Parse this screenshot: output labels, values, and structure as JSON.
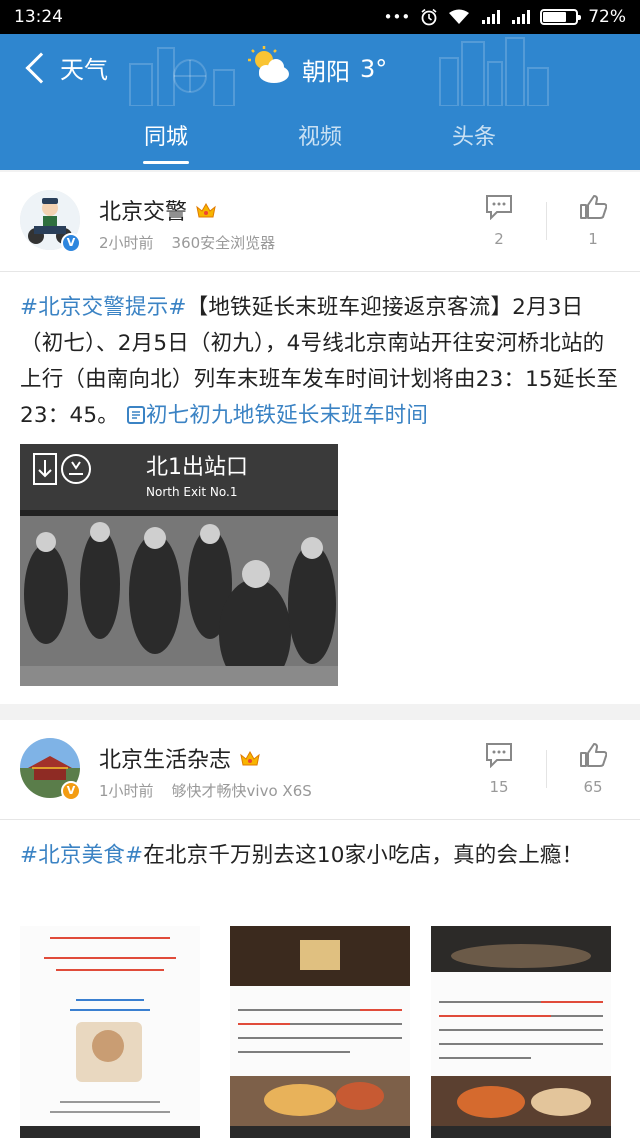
{
  "status_bar": {
    "time": "13:24",
    "battery_text": "72%",
    "battery_level": 0.72,
    "icons": [
      "dots-icon",
      "alarm-icon",
      "wifi-icon",
      "signal-icon",
      "signal-icon",
      "battery-icon"
    ]
  },
  "header": {
    "back_label": "天气",
    "location": "朝阳",
    "temperature": "3°",
    "weather_icon": "partly-cloudy-icon",
    "bg_color": "#2f86cf"
  },
  "tabs": [
    {
      "label": "同城",
      "active": true
    },
    {
      "label": "视频",
      "active": false
    },
    {
      "label": "头条",
      "active": false
    }
  ],
  "posts": [
    {
      "author": "北京交警",
      "time": "2小时前",
      "source": "360安全浏览器",
      "comments": "2",
      "likes": "1",
      "hashtag": "#北京交警提示#",
      "body": "【地铁延长末班车迎接返京客流】2月3日（初七）、2月5日（初九），4号线北京南站开往安河桥北站的上行（由南向北）列车末班车发车时间计划将由23：15延长至23：45。",
      "link": "初七初九地铁延长末班车时间",
      "image_sign_cn": "北1出站口",
      "image_sign_en": "North Exit No.1"
    },
    {
      "author": "北京生活杂志",
      "time": "1小时前",
      "source": "够快才畅快vivo X6S",
      "comments": "15",
      "likes": "65",
      "hashtag": "#北京美食#",
      "body": "在北京千万别去这10家小吃店，真的会上瘾！"
    }
  ],
  "colors": {
    "accent": "#2f86cf",
    "link": "#3b83c4",
    "meta": "#999999"
  }
}
